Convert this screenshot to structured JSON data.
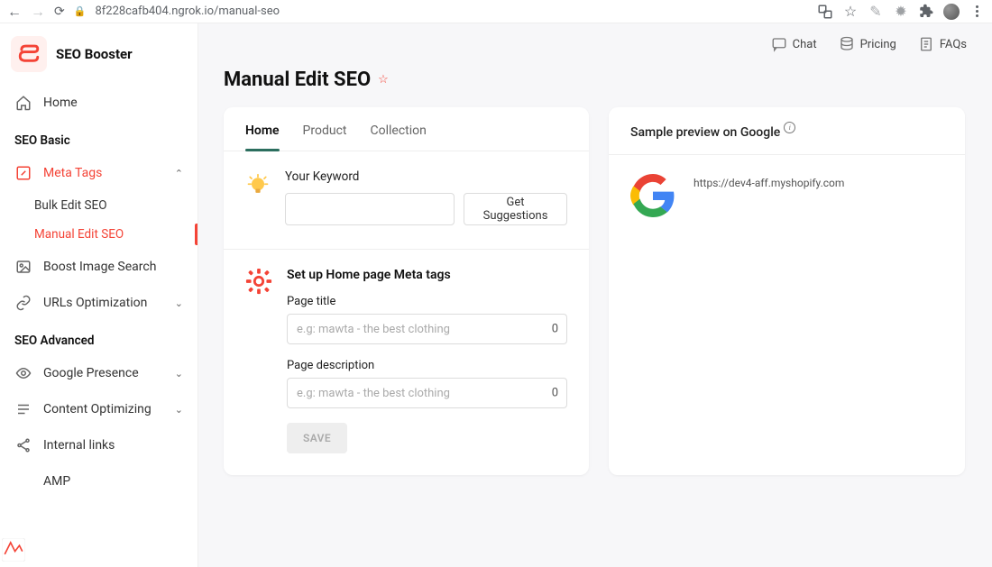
{
  "chrome": {
    "url": "8f228cafb404.ngrok.io/manual-seo"
  },
  "brand": "SEO Booster",
  "sidebar": {
    "home": "Home",
    "section_basic": "SEO Basic",
    "meta_tags": "Meta Tags",
    "bulk_edit": "Bulk Edit SEO",
    "manual_edit": "Manual Edit SEO",
    "boost_image": "Boost Image Search",
    "urls_opt": "URLs Optimization",
    "section_advanced": "SEO Advanced",
    "google_presence": "Google Presence",
    "content_opt": "Content Optimizing",
    "internal_links": "Internal links",
    "amp": "AMP"
  },
  "top": {
    "chat": "Chat",
    "pricing": "Pricing",
    "faqs": "FAQs"
  },
  "page_title": "Manual Edit SEO",
  "tabs": {
    "home": "Home",
    "product": "Product",
    "collection": "Collection"
  },
  "keyword": {
    "label": "Your Keyword",
    "suggest_btn": "Get Suggestions"
  },
  "meta": {
    "heading": "Set up Home page Meta tags",
    "page_title_label": "Page title",
    "page_title_ph": "e.g: mawta - the best clothing",
    "page_title_count": "0",
    "page_desc_label": "Page description",
    "page_desc_ph": "e.g: mawta - the best clothing",
    "page_desc_count": "0",
    "save": "SAVE"
  },
  "preview": {
    "heading": "Sample preview on Google",
    "url": "https://dev4-aff.myshopify.com"
  }
}
